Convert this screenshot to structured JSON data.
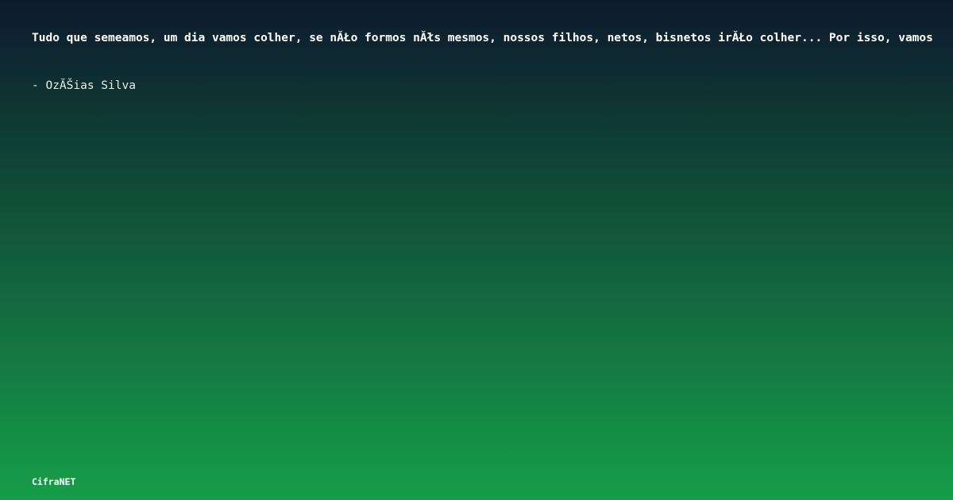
{
  "quote": {
    "text": "Tudo que semeamos, um dia vamos colher, se nĂŁo formos nĂłs mesmos, nossos filhos, netos, bisnetos irĂŁo colher... Por isso, vamos"
  },
  "author": {
    "text": "- OzĂŠias Silva"
  },
  "brand": {
    "text": "CifraNET"
  },
  "colors": {
    "background_top": "#0d1a2e",
    "background_bottom": "#169e48",
    "text": "#ffffff"
  }
}
